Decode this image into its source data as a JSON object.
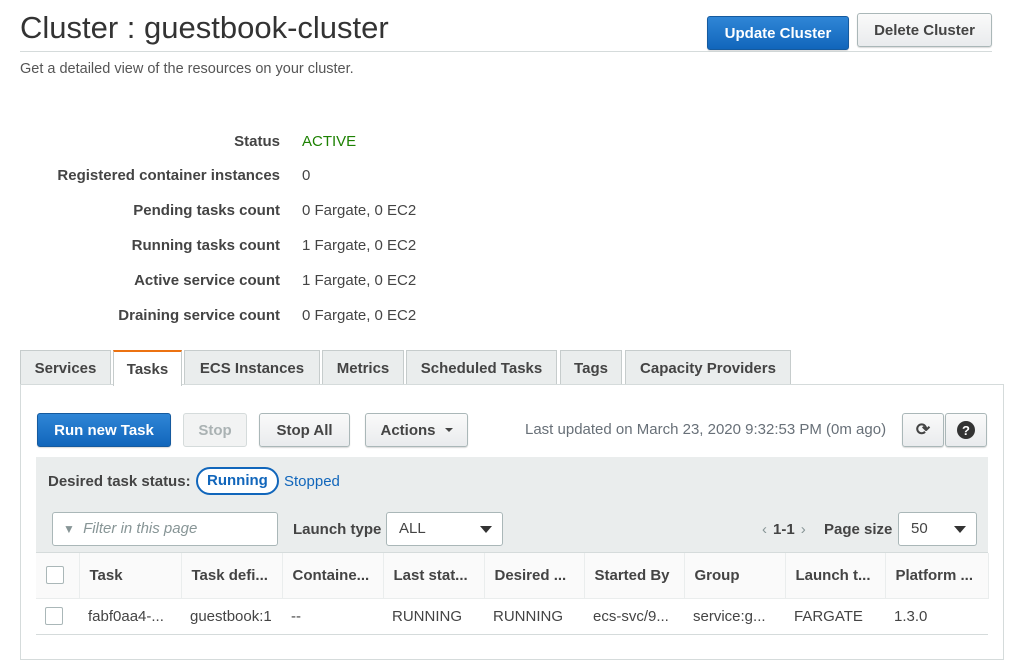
{
  "header": {
    "title": "Cluster : guestbook-cluster",
    "subtitle": "Get a detailed view of the resources on your cluster.",
    "update_label": "Update Cluster",
    "delete_label": "Delete Cluster"
  },
  "details": [
    {
      "label": "Status",
      "value": "ACTIVE"
    },
    {
      "label": "Registered container instances",
      "value": "0"
    },
    {
      "label": "Pending tasks count",
      "value": "0 Fargate, 0 EC2"
    },
    {
      "label": "Running tasks count",
      "value": "1 Fargate, 0 EC2"
    },
    {
      "label": "Active service count",
      "value": "1 Fargate, 0 EC2"
    },
    {
      "label": "Draining service count",
      "value": "0 Fargate, 0 EC2"
    }
  ],
  "tabs": [
    "Services",
    "Tasks",
    "ECS Instances",
    "Metrics",
    "Scheduled Tasks",
    "Tags",
    "Capacity Providers"
  ],
  "toolbar": {
    "run_label": "Run new Task",
    "stop_label": "Stop",
    "stop_all_label": "Stop All",
    "actions_label": "Actions",
    "last_updated": "Last updated on March 23, 2020 9:32:53 PM (0m ago)",
    "refresh_icon": "refresh-icon",
    "help_icon": "help-icon",
    "refresh_glyph": "⟳",
    "help_glyph": "?"
  },
  "filters": {
    "desired_status_label": "Desired task status:",
    "running_label": "Running",
    "stopped_label": "Stopped",
    "filter_placeholder": "Filter in this page",
    "launch_type_label": "Launch type",
    "launch_type_value": "ALL",
    "pager_range": "1-1",
    "page_size_label": "Page size",
    "page_size_value": "50"
  },
  "table": {
    "columns": [
      "Task",
      "Task defi...",
      "Containe...",
      "Last stat...",
      "Desired ...",
      "Started By",
      "Group",
      "Launch t...",
      "Platform ..."
    ],
    "rows": [
      [
        "fabf0aa4-...",
        "guestbook:1",
        "--",
        "RUNNING",
        "RUNNING",
        "ecs-svc/9...",
        "service:g...",
        "FARGATE",
        "1.3.0"
      ]
    ]
  },
  "colors": {
    "primary": "#1166bb",
    "active": "#1d8102",
    "tab_accent": "#ec7211"
  }
}
